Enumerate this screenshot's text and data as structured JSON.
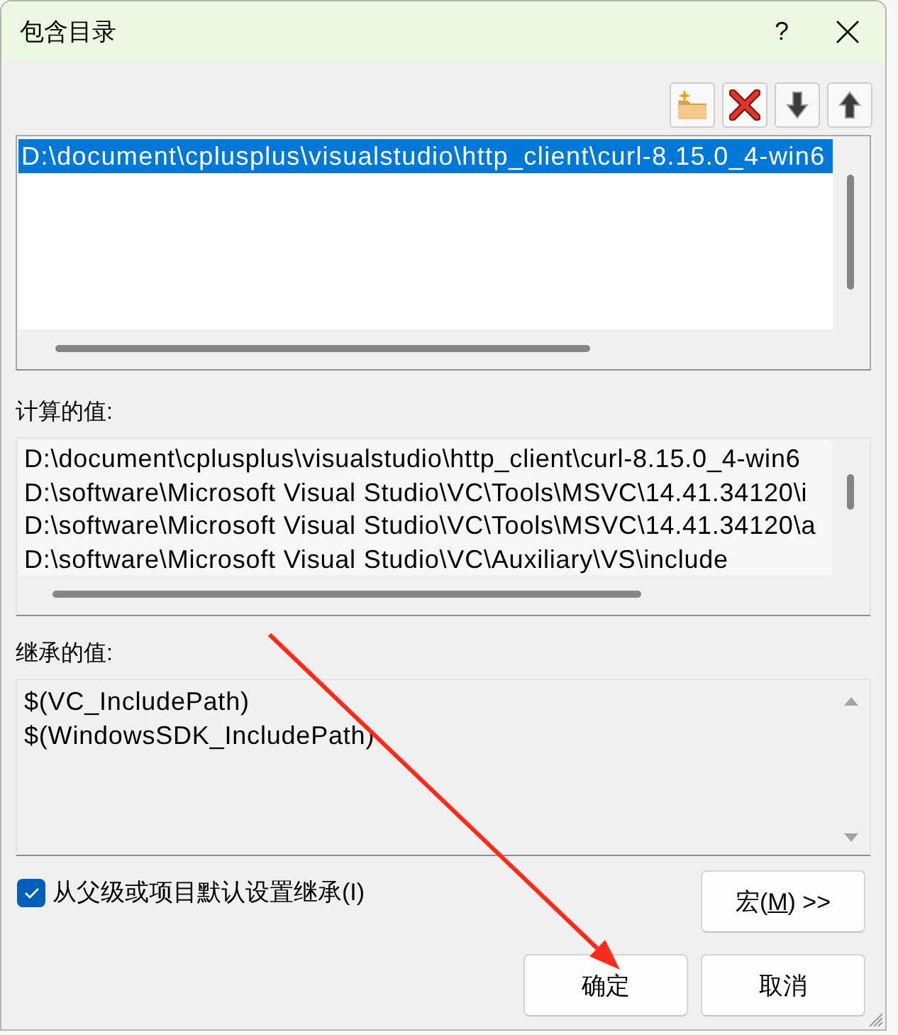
{
  "window": {
    "title": "包含目录",
    "help": "?"
  },
  "toolbar": [
    {
      "kind": "new-folder"
    },
    {
      "kind": "delete"
    },
    {
      "kind": "move-down"
    },
    {
      "kind": "move-up"
    }
  ],
  "entries": [
    {
      "text": "D:\\document\\cplusplus\\visualstudio\\http_client\\curl-8.15.0_4-win6",
      "selected": true
    }
  ],
  "computed": {
    "label": "计算的值:",
    "lines": [
      "D:\\document\\cplusplus\\visualstudio\\http_client\\curl-8.15.0_4-win6",
      "D:\\software\\Microsoft Visual Studio\\VC\\Tools\\MSVC\\14.41.34120\\i",
      "D:\\software\\Microsoft Visual Studio\\VC\\Tools\\MSVC\\14.41.34120\\a",
      "D:\\software\\Microsoft Visual Studio\\VC\\Auxiliary\\VS\\include"
    ]
  },
  "inherited": {
    "label": "继承的值:",
    "lines": [
      "$(VC_IncludePath)",
      "$(WindowsSDK_IncludePath)"
    ]
  },
  "inherit_checkbox": {
    "label": "从父级或项目默认设置继承(I)",
    "checked": true
  },
  "macros_button": {
    "label": "宏(",
    "access_key": "M",
    "label_end": ") >>"
  },
  "buttons": [
    "确定",
    "取消"
  ]
}
